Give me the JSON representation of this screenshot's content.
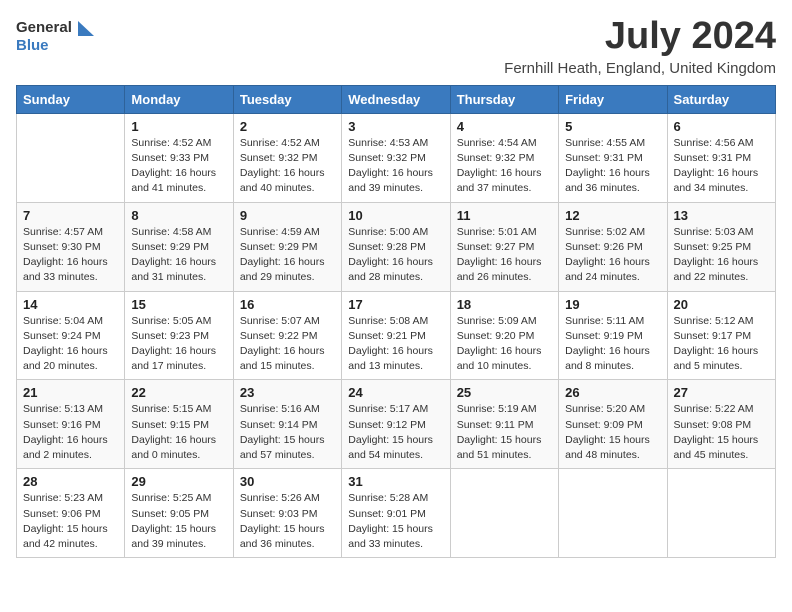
{
  "logo": {
    "general": "General",
    "blue": "Blue"
  },
  "title": {
    "month_year": "July 2024",
    "location": "Fernhill Heath, England, United Kingdom"
  },
  "weekdays": [
    "Sunday",
    "Monday",
    "Tuesday",
    "Wednesday",
    "Thursday",
    "Friday",
    "Saturday"
  ],
  "weeks": [
    [
      {
        "date": "",
        "info": ""
      },
      {
        "date": "1",
        "info": "Sunrise: 4:52 AM\nSunset: 9:33 PM\nDaylight: 16 hours\nand 41 minutes."
      },
      {
        "date": "2",
        "info": "Sunrise: 4:52 AM\nSunset: 9:32 PM\nDaylight: 16 hours\nand 40 minutes."
      },
      {
        "date": "3",
        "info": "Sunrise: 4:53 AM\nSunset: 9:32 PM\nDaylight: 16 hours\nand 39 minutes."
      },
      {
        "date": "4",
        "info": "Sunrise: 4:54 AM\nSunset: 9:32 PM\nDaylight: 16 hours\nand 37 minutes."
      },
      {
        "date": "5",
        "info": "Sunrise: 4:55 AM\nSunset: 9:31 PM\nDaylight: 16 hours\nand 36 minutes."
      },
      {
        "date": "6",
        "info": "Sunrise: 4:56 AM\nSunset: 9:31 PM\nDaylight: 16 hours\nand 34 minutes."
      }
    ],
    [
      {
        "date": "7",
        "info": "Sunrise: 4:57 AM\nSunset: 9:30 PM\nDaylight: 16 hours\nand 33 minutes."
      },
      {
        "date": "8",
        "info": "Sunrise: 4:58 AM\nSunset: 9:29 PM\nDaylight: 16 hours\nand 31 minutes."
      },
      {
        "date": "9",
        "info": "Sunrise: 4:59 AM\nSunset: 9:29 PM\nDaylight: 16 hours\nand 29 minutes."
      },
      {
        "date": "10",
        "info": "Sunrise: 5:00 AM\nSunset: 9:28 PM\nDaylight: 16 hours\nand 28 minutes."
      },
      {
        "date": "11",
        "info": "Sunrise: 5:01 AM\nSunset: 9:27 PM\nDaylight: 16 hours\nand 26 minutes."
      },
      {
        "date": "12",
        "info": "Sunrise: 5:02 AM\nSunset: 9:26 PM\nDaylight: 16 hours\nand 24 minutes."
      },
      {
        "date": "13",
        "info": "Sunrise: 5:03 AM\nSunset: 9:25 PM\nDaylight: 16 hours\nand 22 minutes."
      }
    ],
    [
      {
        "date": "14",
        "info": "Sunrise: 5:04 AM\nSunset: 9:24 PM\nDaylight: 16 hours\nand 20 minutes."
      },
      {
        "date": "15",
        "info": "Sunrise: 5:05 AM\nSunset: 9:23 PM\nDaylight: 16 hours\nand 17 minutes."
      },
      {
        "date": "16",
        "info": "Sunrise: 5:07 AM\nSunset: 9:22 PM\nDaylight: 16 hours\nand 15 minutes."
      },
      {
        "date": "17",
        "info": "Sunrise: 5:08 AM\nSunset: 9:21 PM\nDaylight: 16 hours\nand 13 minutes."
      },
      {
        "date": "18",
        "info": "Sunrise: 5:09 AM\nSunset: 9:20 PM\nDaylight: 16 hours\nand 10 minutes."
      },
      {
        "date": "19",
        "info": "Sunrise: 5:11 AM\nSunset: 9:19 PM\nDaylight: 16 hours\nand 8 minutes."
      },
      {
        "date": "20",
        "info": "Sunrise: 5:12 AM\nSunset: 9:17 PM\nDaylight: 16 hours\nand 5 minutes."
      }
    ],
    [
      {
        "date": "21",
        "info": "Sunrise: 5:13 AM\nSunset: 9:16 PM\nDaylight: 16 hours\nand 2 minutes."
      },
      {
        "date": "22",
        "info": "Sunrise: 5:15 AM\nSunset: 9:15 PM\nDaylight: 16 hours\nand 0 minutes."
      },
      {
        "date": "23",
        "info": "Sunrise: 5:16 AM\nSunset: 9:14 PM\nDaylight: 15 hours\nand 57 minutes."
      },
      {
        "date": "24",
        "info": "Sunrise: 5:17 AM\nSunset: 9:12 PM\nDaylight: 15 hours\nand 54 minutes."
      },
      {
        "date": "25",
        "info": "Sunrise: 5:19 AM\nSunset: 9:11 PM\nDaylight: 15 hours\nand 51 minutes."
      },
      {
        "date": "26",
        "info": "Sunrise: 5:20 AM\nSunset: 9:09 PM\nDaylight: 15 hours\nand 48 minutes."
      },
      {
        "date": "27",
        "info": "Sunrise: 5:22 AM\nSunset: 9:08 PM\nDaylight: 15 hours\nand 45 minutes."
      }
    ],
    [
      {
        "date": "28",
        "info": "Sunrise: 5:23 AM\nSunset: 9:06 PM\nDaylight: 15 hours\nand 42 minutes."
      },
      {
        "date": "29",
        "info": "Sunrise: 5:25 AM\nSunset: 9:05 PM\nDaylight: 15 hours\nand 39 minutes."
      },
      {
        "date": "30",
        "info": "Sunrise: 5:26 AM\nSunset: 9:03 PM\nDaylight: 15 hours\nand 36 minutes."
      },
      {
        "date": "31",
        "info": "Sunrise: 5:28 AM\nSunset: 9:01 PM\nDaylight: 15 hours\nand 33 minutes."
      },
      {
        "date": "",
        "info": ""
      },
      {
        "date": "",
        "info": ""
      },
      {
        "date": "",
        "info": ""
      }
    ]
  ]
}
